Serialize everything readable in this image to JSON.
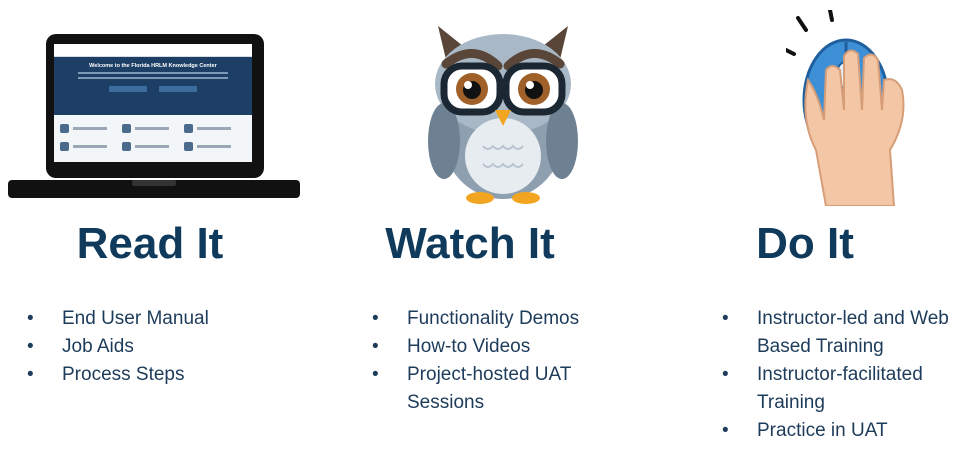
{
  "columns": [
    {
      "heading": "Read It",
      "illustration": "laptop-icon",
      "items": [
        "End User Manual",
        "Job Aids",
        "Process Steps"
      ],
      "screen_title": "Welcome to the Florida HRLM Knowledge Center"
    },
    {
      "heading": "Watch It",
      "illustration": "owl-icon",
      "items": [
        "Functionality Demos",
        "How-to Videos",
        "Project-hosted UAT Sessions"
      ]
    },
    {
      "heading": "Do It",
      "illustration": "hand-mouse-icon",
      "items": [
        "Instructor-led and Web Based Training",
        "Instructor-facilitated Training",
        "Practice in UAT"
      ]
    }
  ],
  "colors": {
    "heading": "#0f3a5c",
    "text": "#1d3b5a",
    "owl_body": "#9fb0c0",
    "mouse": "#3d8fd6"
  }
}
